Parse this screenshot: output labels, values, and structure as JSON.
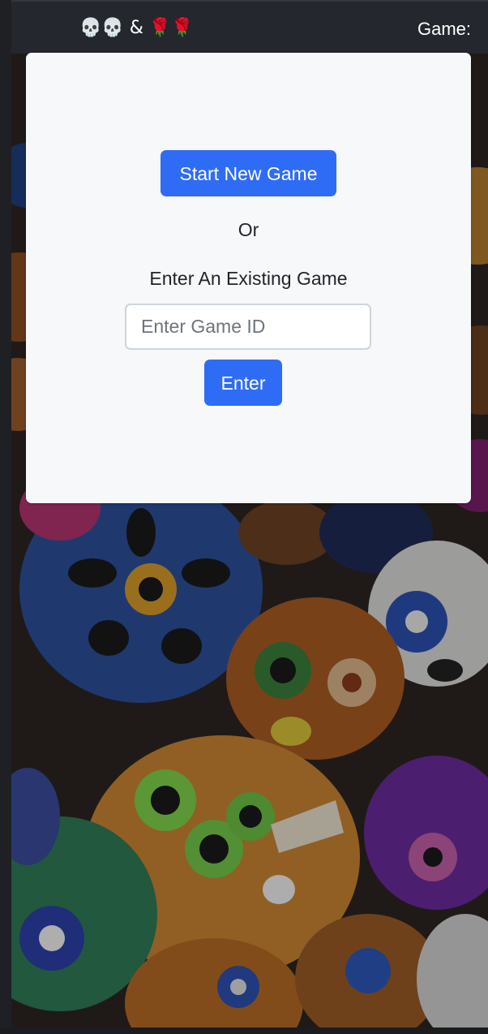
{
  "navbar": {
    "brand": "💀💀 & 🌹🌹",
    "game_label": "Game:"
  },
  "card": {
    "start_button": "Start New Game",
    "or_text": "Or",
    "existing_text": "Enter An Existing Game",
    "game_id_placeholder": "Enter Game ID",
    "game_id_value": "",
    "enter_button": "Enter"
  },
  "background": {
    "image": "painted-sugar-skulls"
  },
  "colors": {
    "navbar": "#24272d",
    "card": "#f7f8fa",
    "primary_button": "#2f6cf6",
    "input_border": "#ced4da"
  }
}
